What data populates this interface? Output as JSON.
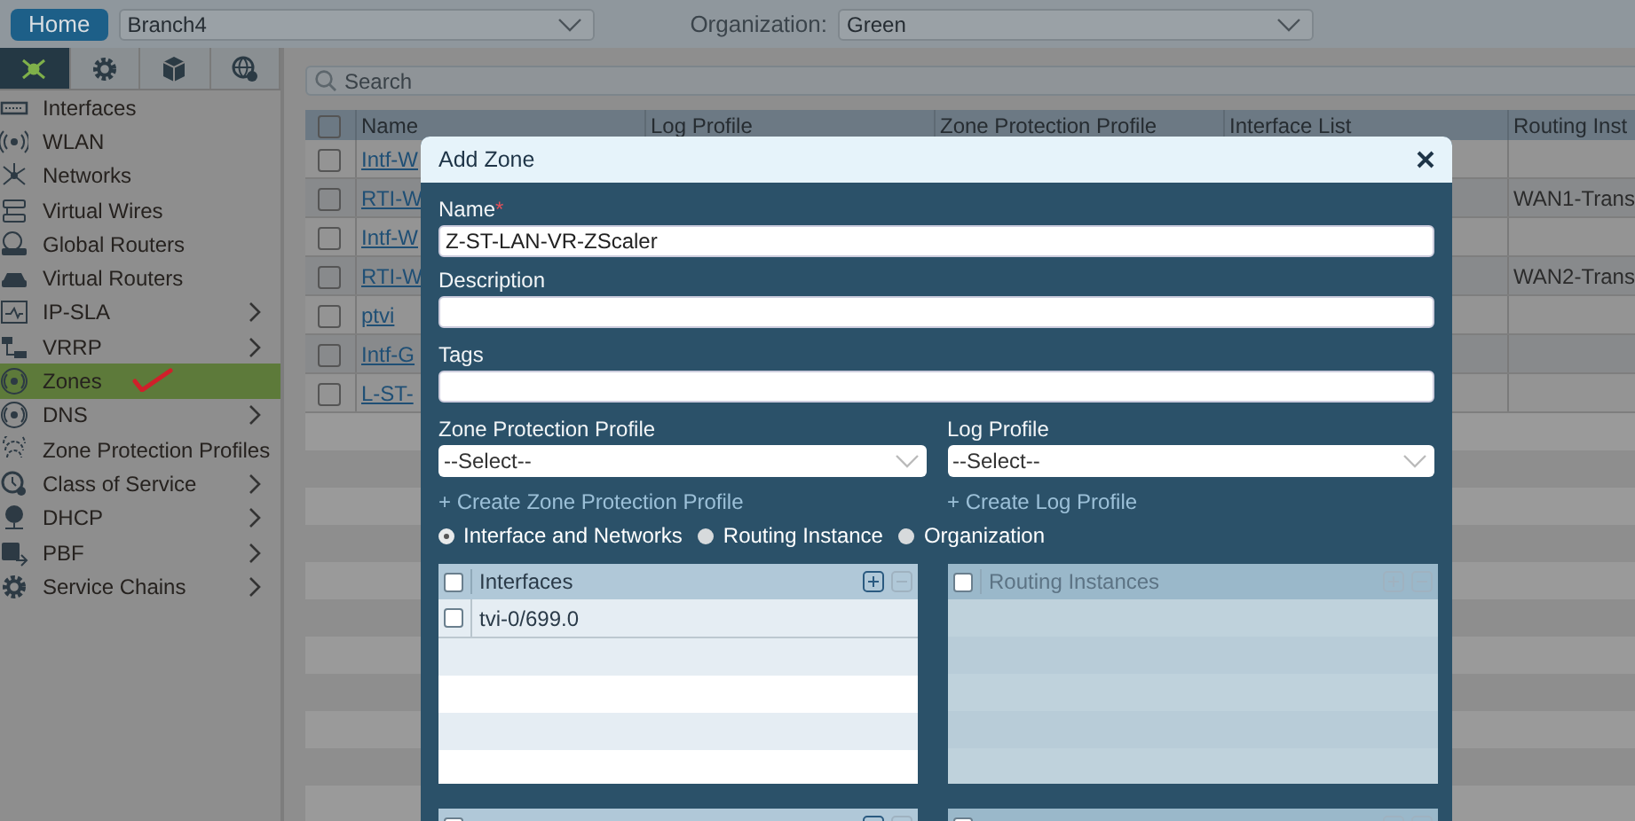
{
  "top_bar": {
    "home_button": "Home",
    "branch": "Branch4",
    "organization_label": "Organization:",
    "organization": "Green"
  },
  "sidebar": {
    "tabs": [
      {
        "kind": "topology",
        "selected": true
      },
      {
        "kind": "gear",
        "selected": false
      },
      {
        "kind": "cube",
        "selected": false
      },
      {
        "kind": "globe",
        "selected": false
      }
    ],
    "items": [
      {
        "label": "Interfaces",
        "selected": false,
        "expandable": false
      },
      {
        "label": "WLAN",
        "selected": false,
        "expandable": false
      },
      {
        "label": "Networks",
        "selected": false,
        "expandable": false
      },
      {
        "label": "Virtual Wires",
        "selected": false,
        "expandable": false
      },
      {
        "label": "Global Routers",
        "selected": false,
        "expandable": false
      },
      {
        "label": "Virtual Routers",
        "selected": false,
        "expandable": false
      },
      {
        "label": "IP-SLA",
        "selected": false,
        "expandable": true
      },
      {
        "label": "VRRP",
        "selected": false,
        "expandable": true
      },
      {
        "label": "Zones",
        "selected": true,
        "expandable": false
      },
      {
        "label": "DNS",
        "selected": false,
        "expandable": true
      },
      {
        "label": "Zone Protection Profiles",
        "selected": false,
        "expandable": false
      },
      {
        "label": "Class of Service",
        "selected": false,
        "expandable": true
      },
      {
        "label": "DHCP",
        "selected": false,
        "expandable": true
      },
      {
        "label": "PBF",
        "selected": false,
        "expandable": true
      },
      {
        "label": "Service Chains",
        "selected": false,
        "expandable": true
      }
    ]
  },
  "search": {
    "placeholder": "Search"
  },
  "table": {
    "columns": [
      "Name",
      "Log Profile",
      "Zone Protection Profile",
      "Interface List",
      "Routing Inst"
    ],
    "rows": [
      {
        "checked": false,
        "name": "Intf-W",
        "routing_instance": ""
      },
      {
        "checked": false,
        "name": "RTI-W",
        "routing_instance": "WAN1-Trans"
      },
      {
        "checked": false,
        "name": "Intf-W",
        "routing_instance": ""
      },
      {
        "checked": false,
        "name": "RTI-W",
        "routing_instance": "WAN2-Trans"
      },
      {
        "checked": false,
        "name": "ptvi",
        "routing_instance": ""
      },
      {
        "checked": false,
        "name": "Intf-G",
        "routing_instance": ""
      },
      {
        "checked": false,
        "name": "L-ST-",
        "routing_instance": ""
      }
    ],
    "all_checked": false
  },
  "dialog": {
    "title": "Add Zone",
    "name": {
      "label": "Name",
      "required_mark": "*",
      "value": "Z-ST-LAN-VR-ZScaler"
    },
    "description": {
      "label": "Description"
    },
    "tags": {
      "label": "Tags"
    },
    "zone_protection_profile": {
      "label": "Zone Protection Profile",
      "value": "--Select--",
      "link": "+ Create Zone Protection Profile"
    },
    "log_profile": {
      "label": "Log Profile",
      "value": "--Select--",
      "link": "+ Create Log Profile"
    },
    "scope": [
      {
        "label": "Interface and Networks",
        "selected": true
      },
      {
        "label": "Routing Instance",
        "selected": false
      },
      {
        "label": "Organization",
        "selected": false
      }
    ],
    "panels": [
      {
        "title": "Interfaces",
        "disabled": false,
        "checked": false,
        "rows": [
          {
            "label": "tvi-0/699.0",
            "checked": false
          }
        ]
      },
      {
        "title": "Routing Instances",
        "disabled": true,
        "checked": false
      },
      {
        "disabled": false,
        "checked": false
      },
      {
        "disabled": true,
        "checked": false
      }
    ]
  }
}
